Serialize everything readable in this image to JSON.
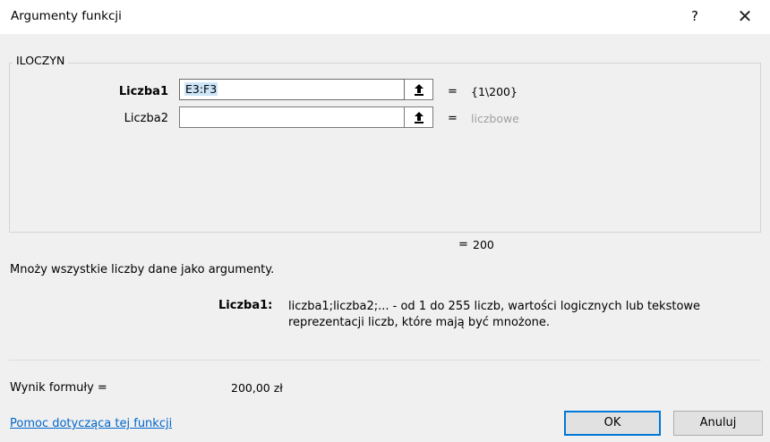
{
  "window": {
    "title": "Argumenty funkcji",
    "help_glyph": "?",
    "close_glyph": "✕"
  },
  "function": {
    "name": "ILOCZYN"
  },
  "arguments": [
    {
      "label": "Liczba1",
      "value": "E3:F3",
      "result": "{1\\200}",
      "eq": "="
    },
    {
      "label": "Liczba2",
      "value": "",
      "result": "liczbowe",
      "eq": "="
    }
  ],
  "result": {
    "eq": "=",
    "value": "200"
  },
  "description": "Mnoży wszystkie liczby dane jako argumenty.",
  "param_help": {
    "name": "Liczba1:",
    "line1": "liczba1;liczba2;... - od 1 do 255 liczb, wartości logicznych lub tekstowe",
    "line2": "reprezentacji liczb, które mają być mnożone."
  },
  "formula_result": {
    "label": "Wynik formuły =",
    "value": "200,00 zł"
  },
  "help_link": "Pomoc dotycząca tej funkcji",
  "buttons": {
    "ok": "OK",
    "cancel": "Anuluj"
  },
  "icons": {
    "ref_button": "collapse-dialog-arrow-icon"
  }
}
